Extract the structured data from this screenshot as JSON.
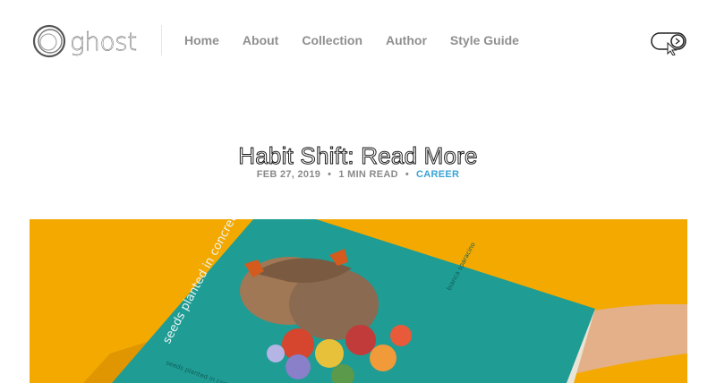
{
  "header": {
    "logo_text": "ghost",
    "nav": [
      "Home",
      "About",
      "Collection",
      "Author",
      "Style Guide"
    ]
  },
  "icons": {
    "logo": "ghost-logo-icon",
    "theme_toggle": "theme-toggle-icon"
  },
  "post": {
    "title": "Habit Shift: Read More",
    "date": "FEB 27, 2019",
    "read_time": "1 MIN READ",
    "tag": "CAREER"
  },
  "hero": {
    "book_title": "seeds planted in concrete",
    "book_spine": "seeds planted in concrete",
    "book_author": "bianca sparacino",
    "colors": {
      "background": "#f4a900",
      "book_cover": "#1f9c94",
      "book_pages": "#e9e4d6"
    }
  }
}
